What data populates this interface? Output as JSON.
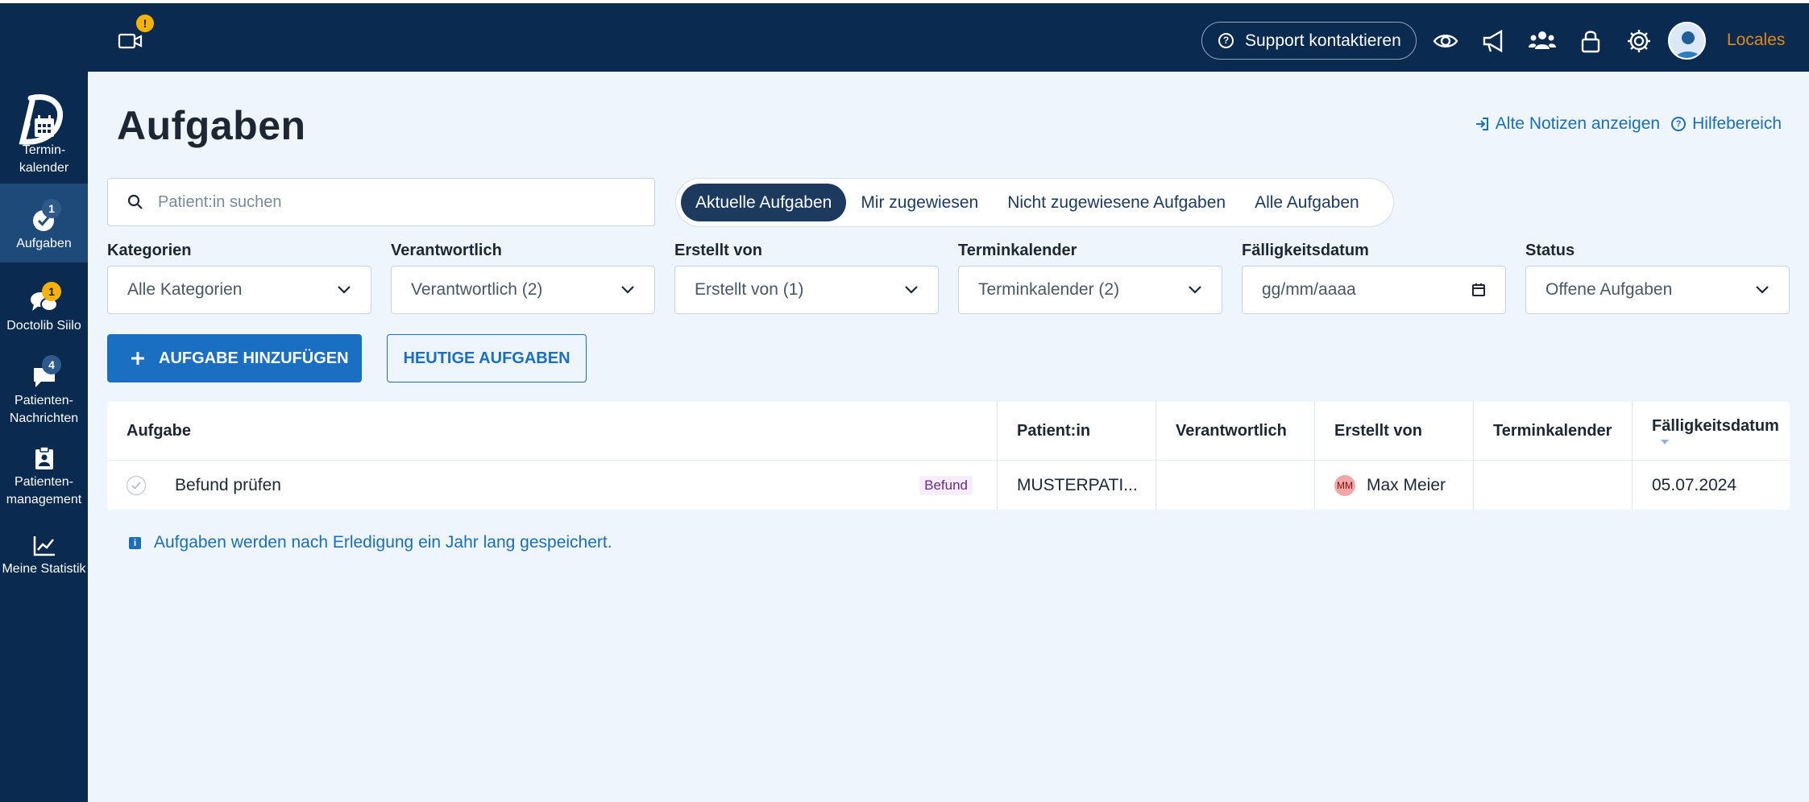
{
  "topbar": {
    "video_badge": "!",
    "support_label": "Support kontaktieren",
    "locales_label": "Locales"
  },
  "sidebar": {
    "items": [
      {
        "label": "Termin-\nkalender",
        "icon": "calendar-icon"
      },
      {
        "label": "Aufgaben",
        "icon": "task-check-icon",
        "badge": "1"
      },
      {
        "label": "Doctolib Siilo",
        "icon": "chat-bubbles-icon",
        "badge": "1"
      },
      {
        "label": "Patienten-\nNachrichten",
        "icon": "message-icon",
        "badge": "4"
      },
      {
        "label": "Patienten-\nmanagement",
        "icon": "clipboard-icon"
      },
      {
        "label": "Meine Statistik",
        "icon": "chart-line-icon"
      }
    ]
  },
  "page": {
    "title": "Aufgaben",
    "link_old_notes": "Alte Notizen anzeigen",
    "link_help": "Hilfebereich"
  },
  "search": {
    "placeholder": "Patient:in suchen"
  },
  "tabs": [
    "Aktuelle Aufgaben",
    "Mir zugewiesen",
    "Nicht zugewiesene Aufgaben",
    "Alle Aufgaben"
  ],
  "filters": [
    {
      "label": "Kategorien",
      "value": "Alle Kategorien"
    },
    {
      "label": "Verantwortlich",
      "value": "Verantwortlich (2)"
    },
    {
      "label": "Erstellt von",
      "value": "Erstellt von (1)"
    },
    {
      "label": "Terminkalender",
      "value": "Terminkalender (2)"
    },
    {
      "label": "Fälligkeitsdatum",
      "value": "gg/mm/aaaa"
    },
    {
      "label": "Status",
      "value": "Offene Aufgaben"
    }
  ],
  "buttons": {
    "add_task": "AUFGABE HINZUFÜGEN",
    "today_tasks": "HEUTIGE AUFGABEN"
  },
  "table": {
    "headers": [
      "Aufgabe",
      "Patient:in",
      "Verantwortlich",
      "Erstellt von",
      "Terminkalender",
      "Fälligkeitsdatum"
    ],
    "rows": [
      {
        "task": "Befund prüfen",
        "category": "Befund",
        "patient": "MUSTERPATI...",
        "responsible": "",
        "creator_initials": "MM",
        "creator": "Max Meier",
        "calendar": "",
        "due_date": "05.07.2024"
      }
    ]
  },
  "info_text": "Aufgaben werden nach Erledigung ein Jahr lang gespeichert.",
  "colors": {
    "navy": "#0a2a4f",
    "primary": "#1a6fc2",
    "background": "#eef5fc",
    "badge_yellow": "#f5b300",
    "locales_orange": "#e0891a"
  }
}
